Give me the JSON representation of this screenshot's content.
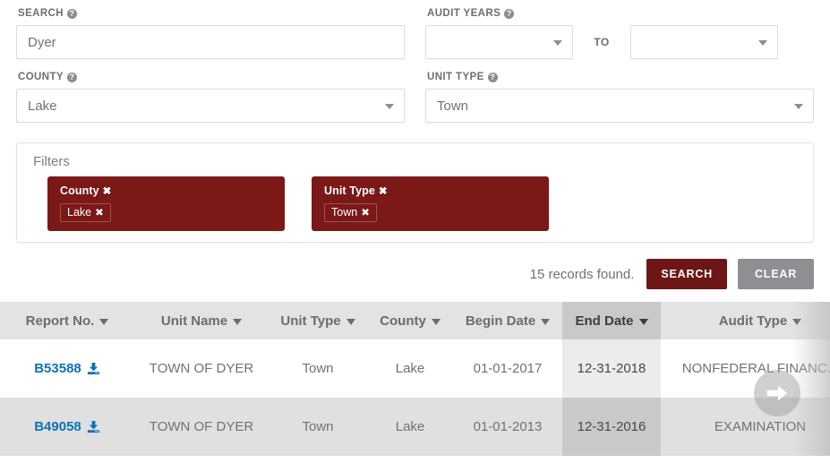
{
  "form": {
    "search": {
      "label": "SEARCH",
      "help_icon": "help-circle-icon",
      "value": "Dyer",
      "placeholder": ""
    },
    "audit_years": {
      "label": "AUDIT YEARS",
      "help_icon": "help-circle-icon",
      "from_value": "",
      "to_label": "TO",
      "to_value": ""
    },
    "county": {
      "label": "COUNTY",
      "help_icon": "help-circle-icon",
      "value": "Lake"
    },
    "unit_type": {
      "label": "UNIT TYPE",
      "help_icon": "help-circle-icon",
      "value": "Town"
    }
  },
  "filters": {
    "title": "Filters",
    "remove_glyph": "✖",
    "chips": [
      {
        "name": "County",
        "values": [
          "Lake"
        ]
      },
      {
        "name": "Unit Type",
        "values": [
          "Town"
        ]
      }
    ]
  },
  "actions": {
    "records_found": "15 records found.",
    "search_label": "SEARCH",
    "clear_label": "CLEAR",
    "search_color": "#6e1616",
    "clear_color": "#8d8f92"
  },
  "table": {
    "sorted_column": "End Date",
    "columns": [
      {
        "label": "Report No.",
        "sorted": false
      },
      {
        "label": "Unit Name",
        "sorted": false
      },
      {
        "label": "Unit Type",
        "sorted": false
      },
      {
        "label": "County",
        "sorted": false
      },
      {
        "label": "Begin Date",
        "sorted": false
      },
      {
        "label": "End Date",
        "sorted": true
      },
      {
        "label": "Audit Type",
        "sorted": false
      }
    ],
    "rows": [
      {
        "report_no": "B53588",
        "download_icon": "download-icon",
        "unit_name": "TOWN OF DYER",
        "unit_type": "Town",
        "county": "Lake",
        "begin_date": "01-01-2017",
        "end_date": "12-31-2018",
        "audit_type": "NONFEDERAL FINANC..."
      },
      {
        "report_no": "B49058",
        "download_icon": "download-icon",
        "unit_name": "TOWN OF DYER",
        "unit_type": "Town",
        "county": "Lake",
        "begin_date": "01-01-2013",
        "end_date": "12-31-2016",
        "audit_type": "EXAMINATION"
      }
    ],
    "scroll_hint_icon": "arrow-right-circle-icon"
  }
}
